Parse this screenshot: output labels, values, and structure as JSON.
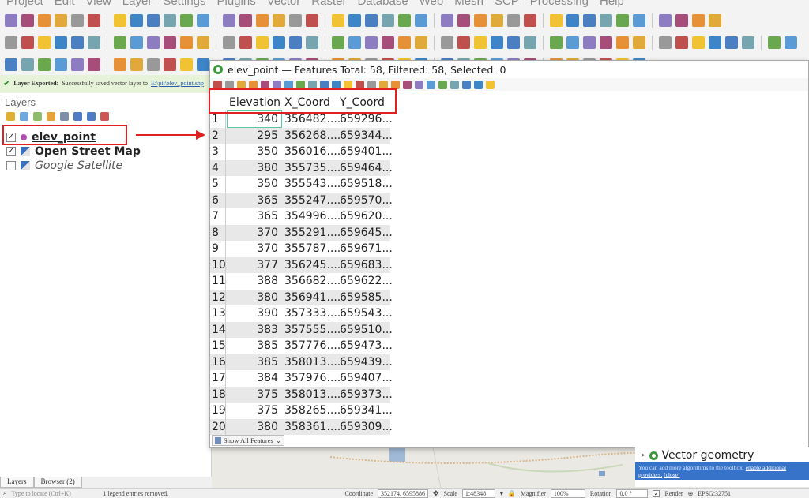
{
  "menubar": {
    "items": [
      "Project",
      "Edit",
      "View",
      "Layer",
      "Settings",
      "Plugins",
      "Vector",
      "Raster",
      "Database",
      "Web",
      "Mesh",
      "SCP",
      "Processing",
      "Help"
    ]
  },
  "banner": {
    "title": "Layer Exported:",
    "message": "Successfully saved vector layer to",
    "link": "E:\\pit\\elev_point.shp"
  },
  "layers_panel": {
    "title": "Layers",
    "layers": [
      {
        "name": "elev_point",
        "checked": "✓",
        "style": "point"
      },
      {
        "name": "Open Street Map",
        "checked": "✓",
        "style": "map"
      },
      {
        "name": "Google Satellite",
        "checked": "",
        "style": "map"
      }
    ]
  },
  "attribute_table": {
    "title": "elev_point — Features Total: 58, Filtered: 58, Selected: 0",
    "columns": [
      "Elevation",
      "X_Coord",
      "Y_Coord"
    ],
    "rows": [
      {
        "n": "1",
        "elevation": "340",
        "x": "356482....",
        "y": "659296..."
      },
      {
        "n": "2",
        "elevation": "295",
        "x": "356268....",
        "y": "659344..."
      },
      {
        "n": "3",
        "elevation": "350",
        "x": "356016....",
        "y": "659401..."
      },
      {
        "n": "4",
        "elevation": "380",
        "x": "355735....",
        "y": "659464..."
      },
      {
        "n": "5",
        "elevation": "350",
        "x": "355543....",
        "y": "659518..."
      },
      {
        "n": "6",
        "elevation": "365",
        "x": "355247....",
        "y": "659570..."
      },
      {
        "n": "7",
        "elevation": "365",
        "x": "354996....",
        "y": "659620..."
      },
      {
        "n": "8",
        "elevation": "370",
        "x": "355291....",
        "y": "659645..."
      },
      {
        "n": "9",
        "elevation": "370",
        "x": "355787....",
        "y": "659671..."
      },
      {
        "n": "10",
        "elevation": "377",
        "x": "356245....",
        "y": "659683..."
      },
      {
        "n": "11",
        "elevation": "388",
        "x": "356682....",
        "y": "659622..."
      },
      {
        "n": "12",
        "elevation": "380",
        "x": "356941....",
        "y": "659585..."
      },
      {
        "n": "13",
        "elevation": "390",
        "x": "357333....",
        "y": "659543..."
      },
      {
        "n": "14",
        "elevation": "383",
        "x": "357555....",
        "y": "659510..."
      },
      {
        "n": "15",
        "elevation": "385",
        "x": "357776....",
        "y": "659473..."
      },
      {
        "n": "16",
        "elevation": "385",
        "x": "358013....",
        "y": "659439..."
      },
      {
        "n": "17",
        "elevation": "384",
        "x": "357976....",
        "y": "659407..."
      },
      {
        "n": "18",
        "elevation": "375",
        "x": "358013....",
        "y": "659373..."
      },
      {
        "n": "19",
        "elevation": "375",
        "x": "358265....",
        "y": "659341..."
      },
      {
        "n": "20",
        "elevation": "380",
        "x": "358361....",
        "y": "659309..."
      }
    ],
    "show_all_label": "Show All Features"
  },
  "vector_panel": {
    "title": "Vector geometry",
    "message": "You can add more algorithms to the toolbox,",
    "link1": "enable additional",
    "link2": "providers.",
    "close": "[close]"
  },
  "bottom_tabs": [
    "Layers",
    "Browser (2)"
  ],
  "statusbar": {
    "locate_placeholder": "Type to locate (Ctrl+K)",
    "legend_msg": "1 legend entries removed.",
    "coordinate_label": "Coordinate",
    "coordinate": "352174, 6595886",
    "scale_label": "Scale",
    "scale": "1:48348",
    "magnifier_label": "Magnifier",
    "magnifier": "100%",
    "rotation_label": "Rotation",
    "rotation": "0.0 °",
    "render_label": "Render",
    "crs": "EPSG:32751"
  },
  "colors": {
    "highlight_red": "#e02020",
    "point_symbol": "#b04cb4",
    "message_blue": "#3773c9"
  }
}
